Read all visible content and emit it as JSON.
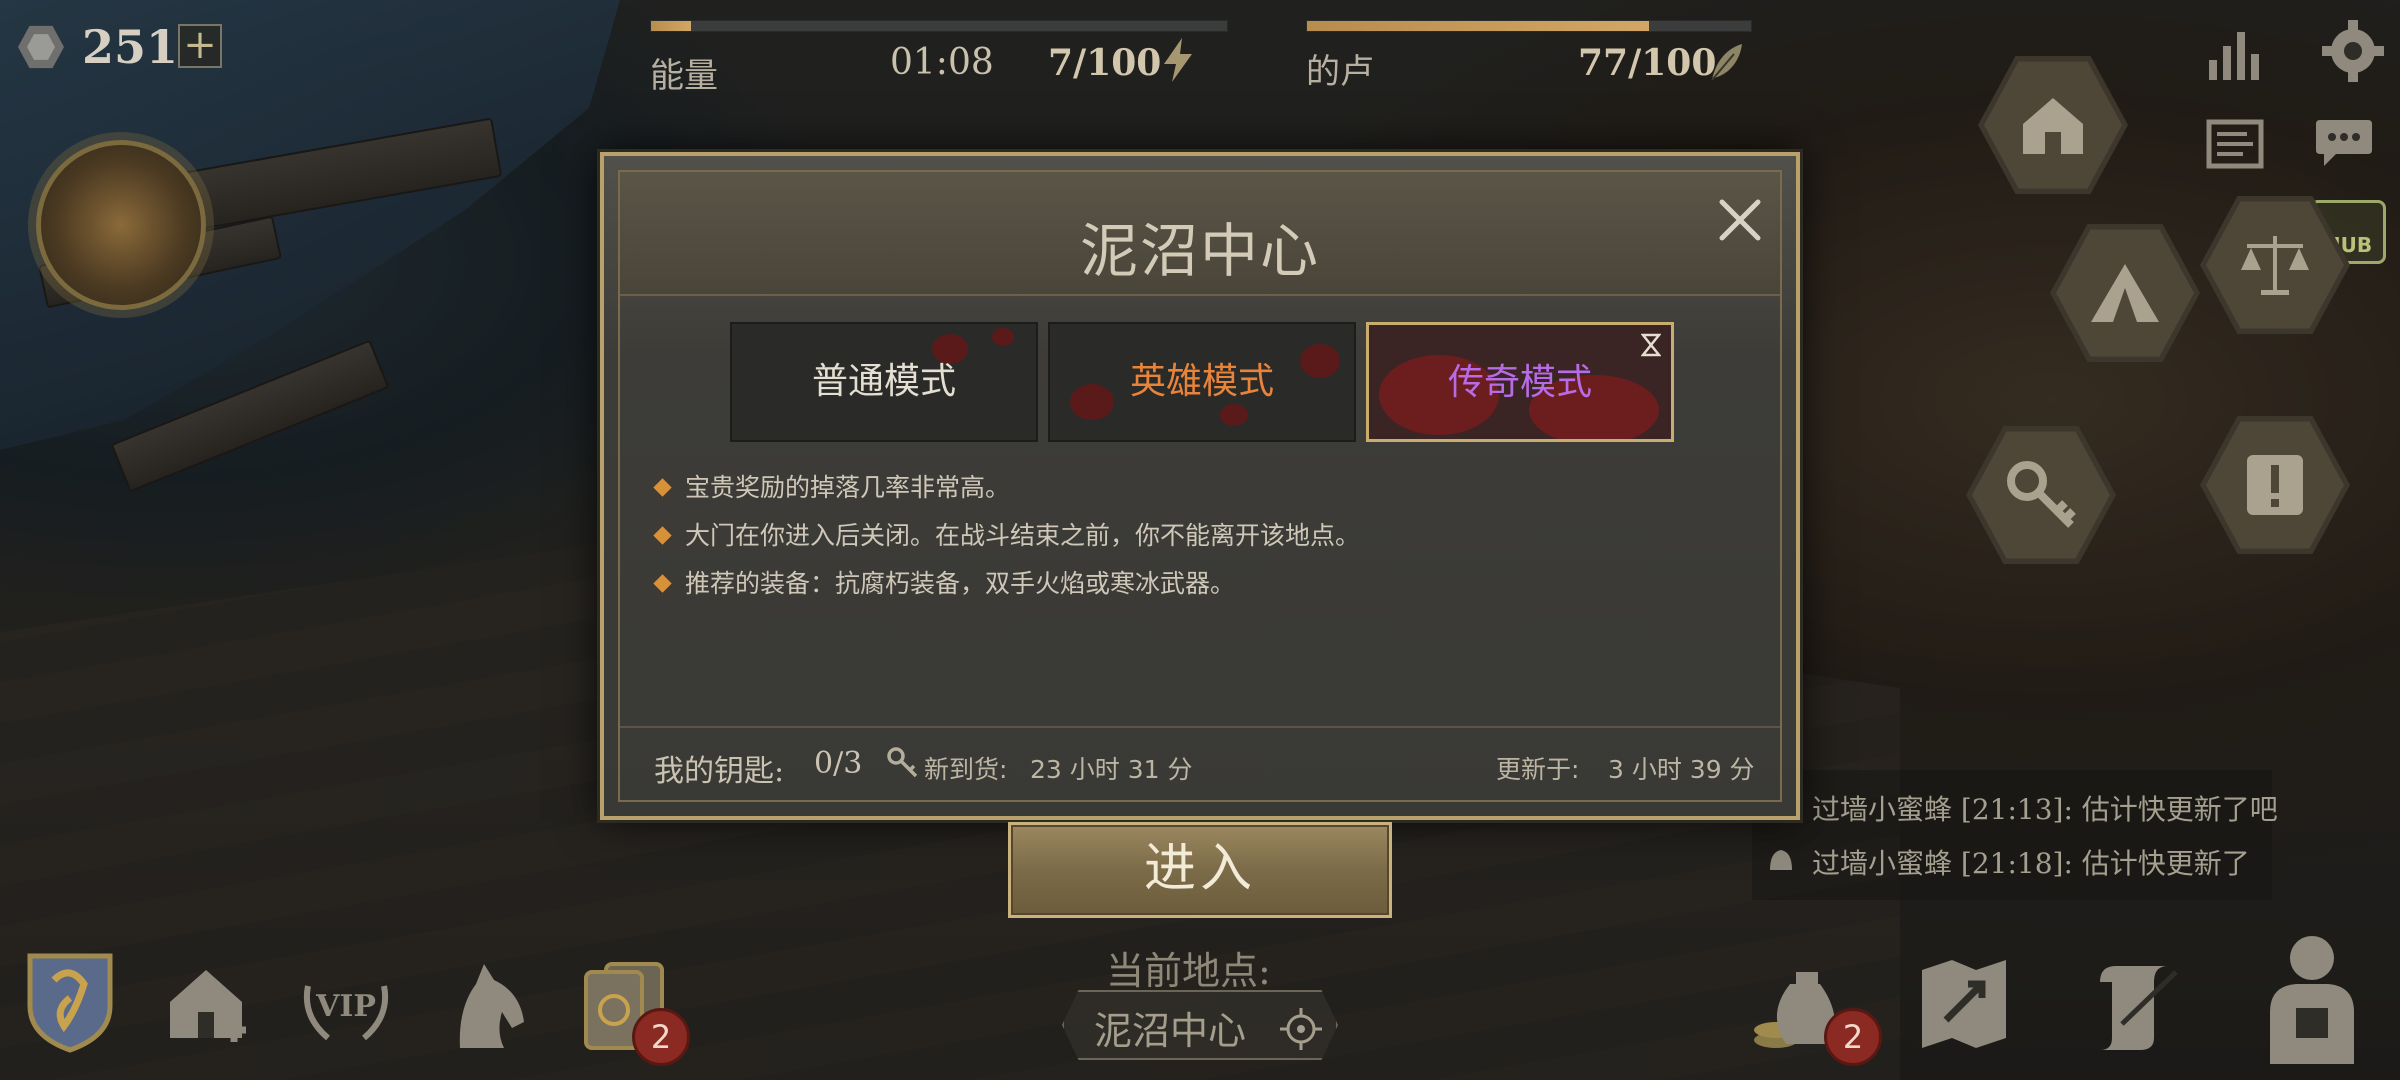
{
  "hud": {
    "gem_count": "251",
    "plus": "+",
    "energy_label": "能量",
    "energy_timer": "01:08",
    "energy_value": "7/100",
    "energy_progress": 0.07,
    "hut_label": "的卢",
    "hut_value": "77/100",
    "hut_progress": 0.77,
    "hub_label": "HUB"
  },
  "dialog": {
    "title": "泥沼中心",
    "modes": [
      {
        "label": "普通模式",
        "color": "#e4dfd2"
      },
      {
        "label": "英雄模式",
        "color": "#e8843a"
      },
      {
        "label": "传奇模式",
        "color": "#b76be6",
        "selected": true
      }
    ],
    "descriptions": [
      "宝贵奖励的掉落几率非常高。",
      "大门在你进入后关闭。在战斗结束之前，你不能离开该地点。",
      "推荐的装备：抗腐朽装备，双手火焰或寒冰武器。"
    ],
    "my_keys_label": "我的钥匙:",
    "my_keys_value": "0/3",
    "restock_label": "新到货:",
    "restock_value": "23 小时 31 分",
    "updated_label": "更新于:",
    "updated_value": "3 小时 39 分"
  },
  "enter_label": "进入",
  "location": {
    "label": "当前地点:",
    "name": "泥沼中心"
  },
  "chat": [
    {
      "text": "过墙小蜜蜂 [21:13]: 估计快更新了吧"
    },
    {
      "text": "过墙小蜜蜂 [21:18]: 估计快更新了"
    }
  ],
  "bottom_bar": {
    "cards_badge": "2",
    "coins_badge": "2",
    "vip_label": "VIP"
  },
  "colors": {
    "gold": "#b9a16b",
    "legend_purple": "#b76be6",
    "hero_orange": "#e8843a",
    "badge_red": "#8a2a22"
  }
}
